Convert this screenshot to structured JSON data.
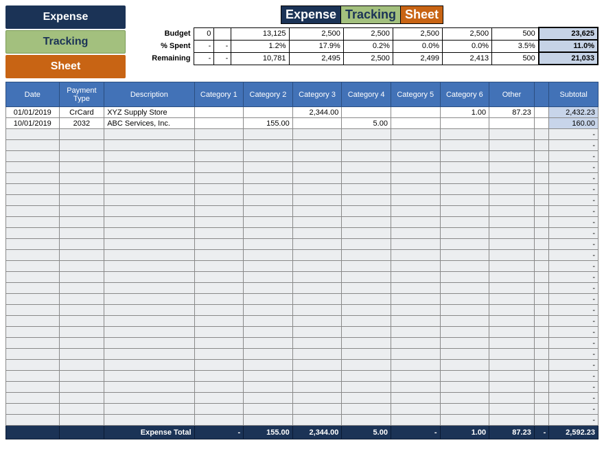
{
  "brand": {
    "l1": "Expense",
    "l2": "Tracking",
    "l3": "Sheet"
  },
  "banner": {
    "p1": "Expense",
    "p2": "Tracking",
    "p3": "Sheet"
  },
  "summary": {
    "rows": [
      {
        "label": "Budget",
        "c1": "0",
        "c2": "",
        "c3": "13,125",
        "c4": "2,500",
        "c5": "2,500",
        "c6": "2,500",
        "c7": "2,500",
        "c8": "500",
        "total": "23,625"
      },
      {
        "label": "% Spent",
        "c1": "-",
        "c2": "-",
        "c3": "1.2%",
        "c4": "17.9%",
        "c5": "0.2%",
        "c6": "0.0%",
        "c7": "0.0%",
        "c8": "3.5%",
        "total": "11.0%"
      },
      {
        "label": "Remaining",
        "c1": "-",
        "c2": "-",
        "c3": "10,781",
        "c4": "2,495",
        "c5": "2,500",
        "c6": "2,499",
        "c7": "2,413",
        "c8": "500",
        "total": "21,033"
      }
    ]
  },
  "headers": {
    "date": "Date",
    "ptype": "Payment Type",
    "desc": "Description",
    "c1": "Category 1",
    "c2": "Category 2",
    "c3": "Category 3",
    "c4": "Category 4",
    "c5": "Category 5",
    "c6": "Category 6",
    "other": "Other",
    "sub": "Subtotal"
  },
  "rows": [
    {
      "date": "01/01/2019",
      "ptype": "CrCard",
      "desc": "XYZ Supply Store",
      "c1": "",
      "c2": "",
      "c3": "2,344.00",
      "c4": "",
      "c5": "",
      "c6": "1.00",
      "other": "87.23",
      "sub": "2,432.23"
    },
    {
      "date": "10/01/2019",
      "ptype": "2032",
      "desc": "ABC Services, Inc.",
      "c1": "",
      "c2": "155.00",
      "c3": "",
      "c4": "5.00",
      "c5": "",
      "c6": "",
      "other": "",
      "sub": "160.00"
    }
  ],
  "empty_sub": "-",
  "empty_count": 27,
  "footer": {
    "label": "Expense Total",
    "c1": "-",
    "c2": "155.00",
    "c3": "2,344.00",
    "c4": "5.00",
    "c5": "-",
    "c6": "1.00",
    "other": "87.23",
    "spacer": "-",
    "sub": "2,592.23"
  },
  "chart_data": {
    "type": "table",
    "title": "Expense Tracking Sheet",
    "budget_totals": {
      "categories": [
        "Category 1",
        "Category 2",
        "Category 3",
        "Category 4",
        "Category 5",
        "Category 6",
        "Other"
      ],
      "budget": [
        0,
        null,
        13125,
        2500,
        2500,
        2500,
        2500,
        500
      ],
      "pct_spent": [
        null,
        null,
        1.2,
        17.9,
        0.2,
        0.0,
        0.0,
        3.5
      ],
      "remaining": [
        null,
        null,
        10781,
        2495,
        2500,
        2499,
        2413,
        500
      ],
      "grand_budget": 23625,
      "grand_pct_spent": 11.0,
      "grand_remaining": 21033
    },
    "expenses": [
      {
        "date": "2019-01-01",
        "payment_type": "CrCard",
        "description": "XYZ Supply Store",
        "Category 3": 2344.0,
        "Category 6": 1.0,
        "Other": 87.23,
        "subtotal": 2432.23
      },
      {
        "date": "2019-10-01",
        "payment_type": "2032",
        "description": "ABC Services, Inc.",
        "Category 2": 155.0,
        "Category 4": 5.0,
        "subtotal": 160.0
      }
    ],
    "expense_totals": {
      "Category 1": 0,
      "Category 2": 155.0,
      "Category 3": 2344.0,
      "Category 4": 5.0,
      "Category 5": 0,
      "Category 6": 1.0,
      "Other": 87.23,
      "grand_total": 2592.23
    }
  }
}
